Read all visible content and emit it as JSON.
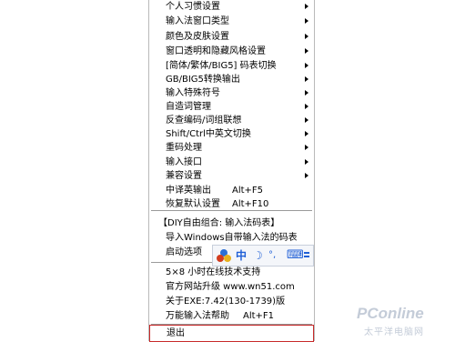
{
  "menu": {
    "submenu_items": [
      {
        "label": "个人习惯设置"
      },
      {
        "label": "输入法窗口类型"
      },
      {
        "label": "颜色及皮肤设置"
      },
      {
        "label": "窗口透明和隐藏风格设置"
      },
      {
        "label": "[简体/繁体/BIG5] 码表切换"
      },
      {
        "label": "GB/BIG5转换输出"
      },
      {
        "label": "输入特殊符号"
      },
      {
        "label": "自造词管理"
      },
      {
        "label": "反查编码/词组联想"
      },
      {
        "label": "Shift/Ctrl中英文切换"
      },
      {
        "label": "重码处理"
      },
      {
        "label": "输入接口"
      },
      {
        "label": "兼容设置"
      }
    ],
    "shortcut_items": [
      {
        "label": "中译英输出",
        "shortcut": "Alt+F5"
      },
      {
        "label": "恢复默认设置",
        "shortcut": "Alt+F10"
      }
    ],
    "diy_combo": "【DIY自由组合: 输入法码表】",
    "import_windows": "导入Windows自带输入法的码表",
    "startup_options": "启动选项",
    "support": "5×8 小时在线技术支持",
    "website_upgrade": "官方网站升级 www.wn51.com",
    "about": "关于EXE:7.42(130-1739)版",
    "help_label": "万能输入法帮助",
    "help_shortcut": "Alt+F1",
    "exit": "退出"
  },
  "toolbar": {
    "items": [
      {
        "icon": "logo-icon",
        "glyph": "",
        "color": "#d23c1e"
      },
      {
        "icon": "chinese-mode-icon",
        "glyph": "中",
        "color": "#1f5fd6"
      },
      {
        "icon": "half-width-icon",
        "glyph": "☽",
        "color": "#1f5fd6"
      },
      {
        "icon": "punctuation-icon",
        "glyph": "°,",
        "color": "#1f5fd6"
      },
      {
        "icon": "keyboard-icon",
        "glyph": "⌨",
        "color": "#1f5fd6"
      },
      {
        "icon": "menu-icon",
        "glyph": "",
        "color": "#1f5fd6"
      }
    ]
  },
  "watermark": {
    "brand": "PConline",
    "sub": "太平洋电脑网"
  }
}
